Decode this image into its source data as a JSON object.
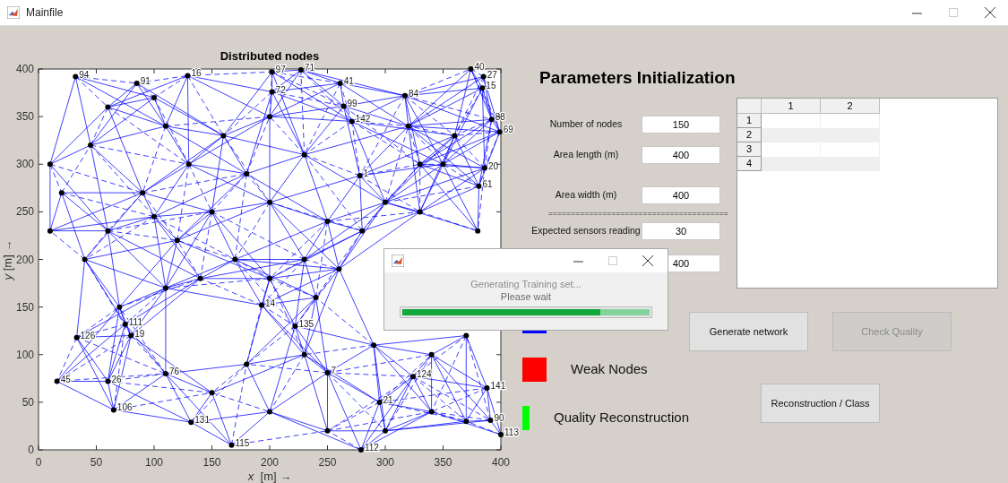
{
  "window": {
    "title": "Mainfile"
  },
  "plot": {
    "chart_data": {
      "type": "scatter",
      "title": "Distributed nodes",
      "xlabel": "*x*  [m] →",
      "ylabel": "*y* [m] →",
      "xlim": [
        0,
        400
      ],
      "ylim": [
        0,
        400
      ],
      "xticks": [
        0,
        50,
        100,
        150,
        200,
        250,
        300,
        350,
        400
      ],
      "yticks": [
        0,
        50,
        100,
        150,
        200,
        250,
        300,
        350,
        400
      ],
      "x": [
        32,
        85,
        129,
        202,
        227,
        261,
        317,
        374,
        385,
        384,
        392,
        399,
        386,
        381,
        271,
        278,
        193,
        222,
        250,
        324,
        388,
        391,
        400,
        279,
        295,
        167,
        80,
        75,
        33,
        16,
        60,
        65,
        110,
        132,
        202,
        264,
        10,
        20,
        45,
        60,
        100,
        110,
        130,
        90,
        60,
        100,
        150,
        180,
        200,
        230,
        250,
        170,
        140,
        110,
        40,
        70,
        200,
        230,
        280,
        330,
        350,
        360,
        330,
        300,
        260,
        370,
        340,
        290,
        230,
        180,
        150,
        200,
        250,
        300,
        340,
        370,
        10,
        380,
        120,
        240,
        160,
        200,
        320
      ],
      "series": [
        {
          "color": "#000000",
          "values": [
            392,
            385,
            393,
            397,
            399,
            385,
            372,
            400,
            392,
            380,
            347,
            334,
            296,
            277,
            345,
            288,
            152,
            130,
            81,
            77,
            65,
            31,
            16,
            0,
            50,
            5,
            120,
            132,
            118,
            72,
            72,
            42,
            80,
            29,
            376,
            361,
            300,
            270,
            320,
            360,
            370,
            340,
            300,
            270,
            230,
            245,
            250,
            290,
            260,
            310,
            240,
            200,
            180,
            170,
            200,
            150,
            180,
            200,
            230,
            250,
            300,
            330,
            300,
            260,
            190,
            120,
            100,
            110,
            100,
            90,
            60,
            40,
            20,
            20,
            40,
            30,
            230,
            230,
            220,
            160,
            330,
            350,
            340
          ]
        }
      ],
      "annotations": [
        {
          "x": 32,
          "y": 392,
          "text": "94"
        },
        {
          "x": 85,
          "y": 385,
          "text": "91"
        },
        {
          "x": 129,
          "y": 393,
          "text": "16"
        },
        {
          "x": 202,
          "y": 397,
          "text": "97"
        },
        {
          "x": 227,
          "y": 399,
          "text": "71"
        },
        {
          "x": 261,
          "y": 385,
          "text": "41"
        },
        {
          "x": 317,
          "y": 372,
          "text": "84"
        },
        {
          "x": 374,
          "y": 400,
          "text": "40"
        },
        {
          "x": 385,
          "y": 392,
          "text": "27"
        },
        {
          "x": 384,
          "y": 380,
          "text": "15"
        },
        {
          "x": 392,
          "y": 347,
          "text": "88"
        },
        {
          "x": 399,
          "y": 334,
          "text": "69"
        },
        {
          "x": 386,
          "y": 296,
          "text": "20"
        },
        {
          "x": 381,
          "y": 277,
          "text": "61"
        },
        {
          "x": 271,
          "y": 345,
          "text": "142"
        },
        {
          "x": 278,
          "y": 288,
          "text": "1"
        },
        {
          "x": 193,
          "y": 152,
          "text": "14"
        },
        {
          "x": 222,
          "y": 130,
          "text": "135"
        },
        {
          "x": 250,
          "y": 81,
          "text": "7"
        },
        {
          "x": 324,
          "y": 77,
          "text": "124"
        },
        {
          "x": 388,
          "y": 65,
          "text": "141"
        },
        {
          "x": 391,
          "y": 31,
          "text": "90"
        },
        {
          "x": 400,
          "y": 16,
          "text": "113"
        },
        {
          "x": 279,
          "y": 0,
          "text": "112"
        },
        {
          "x": 295,
          "y": 50,
          "text": "21"
        },
        {
          "x": 167,
          "y": 5,
          "text": "115"
        },
        {
          "x": 80,
          "y": 120,
          "text": "19"
        },
        {
          "x": 75,
          "y": 132,
          "text": "111"
        },
        {
          "x": 33,
          "y": 118,
          "text": "126"
        },
        {
          "x": 16,
          "y": 72,
          "text": "45"
        },
        {
          "x": 60,
          "y": 72,
          "text": "26"
        },
        {
          "x": 65,
          "y": 42,
          "text": "106"
        },
        {
          "x": 110,
          "y": 80,
          "text": "76"
        },
        {
          "x": 132,
          "y": 29,
          "text": "131"
        },
        {
          "x": 202,
          "y": 376,
          "text": "72"
        },
        {
          "x": 264,
          "y": 361,
          "text": "99"
        }
      ]
    }
  },
  "panel": {
    "heading": "Parameters Initialization",
    "fields": [
      {
        "kind": "field",
        "label": "Number of nodes",
        "value": "150"
      },
      {
        "kind": "field",
        "label": "Area length (m)",
        "value": "400"
      },
      {
        "kind": "field",
        "label": "Area width (m)",
        "value": "400"
      },
      {
        "kind": "divider",
        "text": "========================================"
      },
      {
        "kind": "field",
        "label": "Expected sensors reading",
        "value": "30"
      },
      {
        "kind": "field",
        "value": "400"
      }
    ],
    "table": {
      "columns": [
        "1",
        "2"
      ],
      "rows": [
        "1",
        "2",
        "3",
        "4"
      ]
    },
    "legend": [
      {
        "color": "#0000ff"
      },
      {
        "color": "#ff0000",
        "label": "Weak Nodes"
      },
      {
        "color": "#00ff00",
        "label": "Quality Reconstruction"
      }
    ],
    "buttons": [
      {
        "label": "Generate network",
        "disabled": false
      },
      {
        "label": "Check Quality",
        "disabled": true
      },
      {
        "label": "Reconstruction / Class",
        "disabled": false
      }
    ]
  },
  "dialog": {
    "messages": [
      "Generating Training set...",
      "Please wait"
    ],
    "level": 0.8
  }
}
